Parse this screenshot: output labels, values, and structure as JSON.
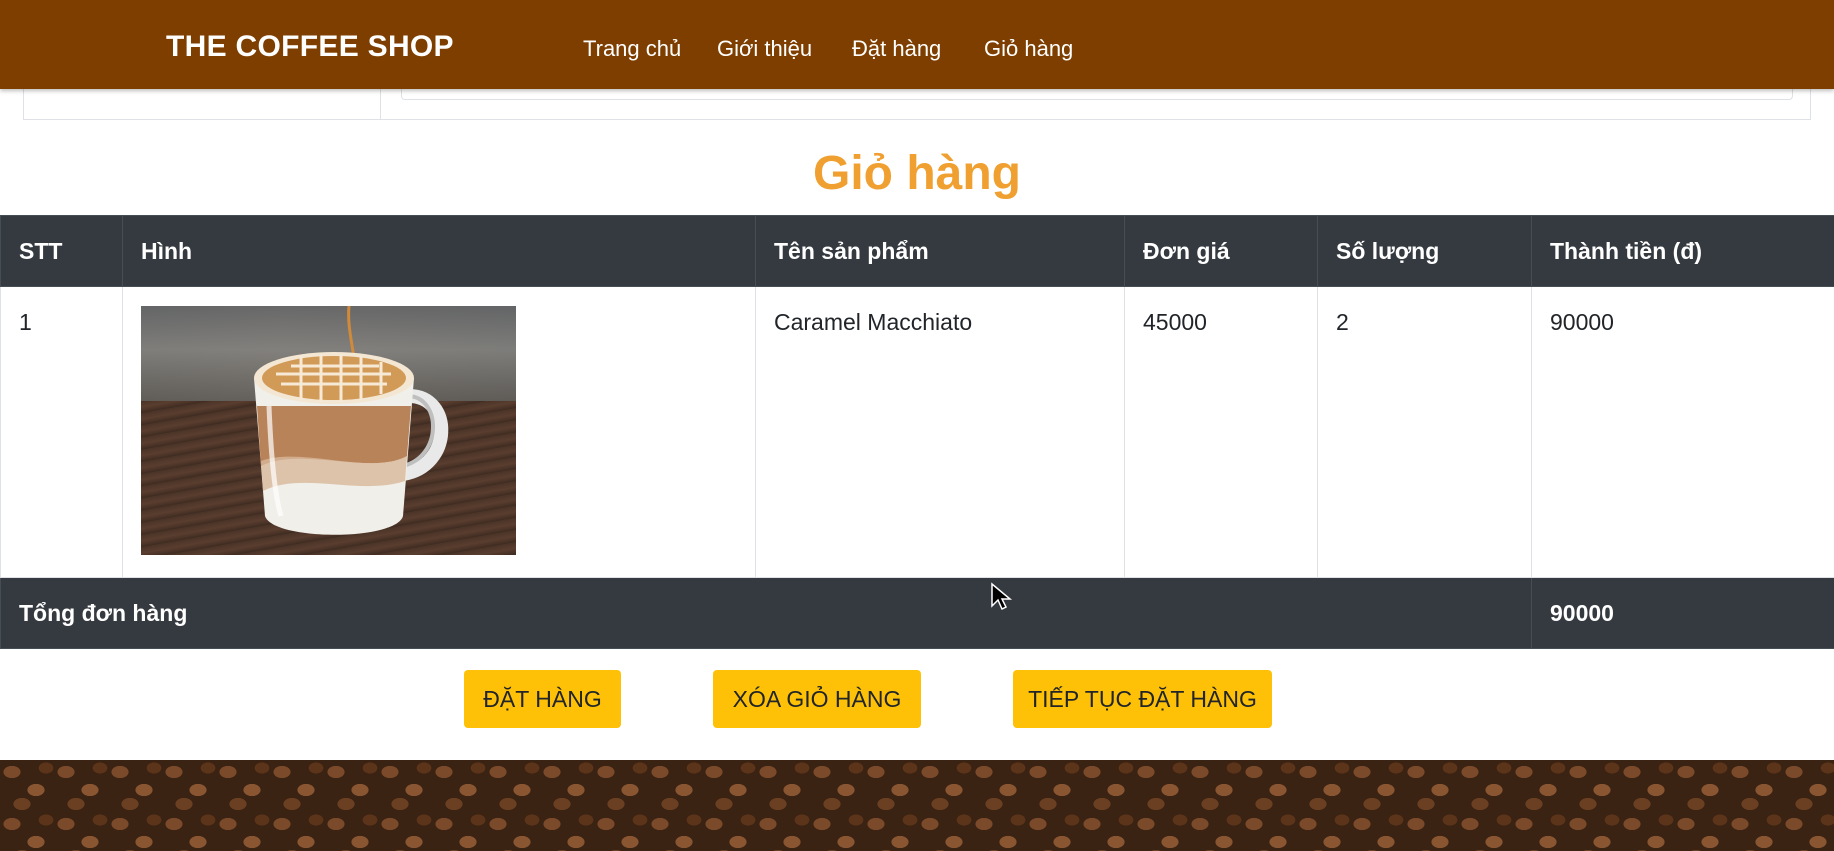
{
  "header": {
    "brand": "THE COFFEE SHOP",
    "nav": [
      {
        "label": "Trang chủ"
      },
      {
        "label": "Giới thiệu"
      },
      {
        "label": "Đặt hàng"
      },
      {
        "label": "Giỏ hàng"
      }
    ],
    "bg_color": "#7e3e00"
  },
  "page": {
    "title": "Giỏ hàng",
    "title_color": "#f0a030"
  },
  "table": {
    "columns": [
      "STT",
      "Hình",
      "Tên sản phẩm",
      "Đơn giá",
      "Số lượng",
      "Thành tiền (đ)"
    ],
    "rows": [
      {
        "stt": "1",
        "image": "caramel-macchiato-photo",
        "name": "Caramel Macchiato",
        "price": "45000",
        "qty": "2",
        "total": "90000"
      }
    ],
    "footer": {
      "label": "Tổng đơn hàng",
      "total": "90000"
    }
  },
  "actions": {
    "order": "ĐẶT HÀNG",
    "clear_cart": "XÓA GIỎ HÀNG",
    "continue": "TIẾP TỤC ĐẶT HÀNG",
    "button_color": "#ffc107"
  }
}
